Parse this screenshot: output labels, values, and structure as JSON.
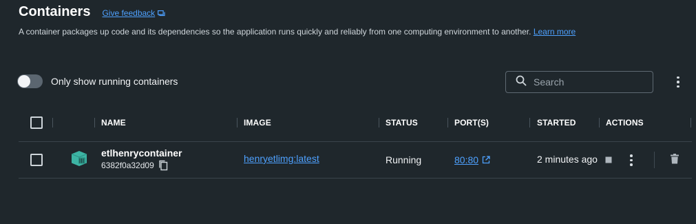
{
  "header": {
    "title": "Containers",
    "feedback_label": "Give feedback"
  },
  "description": {
    "text": "A container packages up code and its dependencies so the application runs quickly and reliably from one computing environment to another.",
    "learn_more": "Learn more"
  },
  "filter": {
    "toggle_label": "Only show running containers",
    "toggle_on": false
  },
  "search": {
    "placeholder": "Search",
    "value": ""
  },
  "table": {
    "columns": [
      "NAME",
      "IMAGE",
      "STATUS",
      "PORT(S)",
      "STARTED",
      "ACTIONS"
    ],
    "rows": [
      {
        "name": "etlhenrycontainer",
        "id": "6382f0a32d09",
        "image": "henryetlimg:latest",
        "status": "Running",
        "ports": "80:80",
        "started": "2 minutes ago"
      }
    ]
  },
  "colors": {
    "background": "#1f272c",
    "link": "#4ea1ff",
    "container_icon": "#3db4a4"
  },
  "icons": [
    "chat-icon",
    "search-icon",
    "kebab-menu-icon",
    "container-icon",
    "copy-icon",
    "external-link-icon",
    "stop-icon",
    "trash-icon"
  ]
}
